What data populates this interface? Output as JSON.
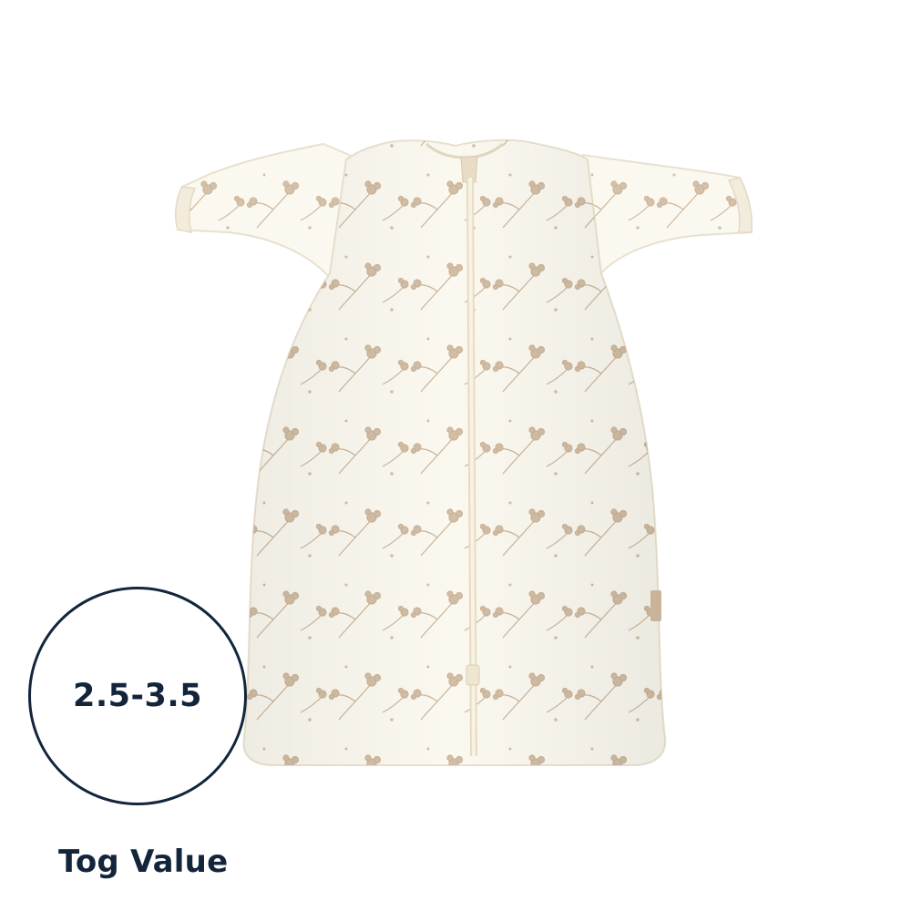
{
  "product": {
    "image_subject": "baby sleeping bag with detachable sleeves",
    "fabric_color": "#fbf8ef",
    "print_color": "#cdb79d"
  },
  "tog": {
    "value_text": "2.5-3.5",
    "label": "Tog Value",
    "color": "#13253b"
  }
}
